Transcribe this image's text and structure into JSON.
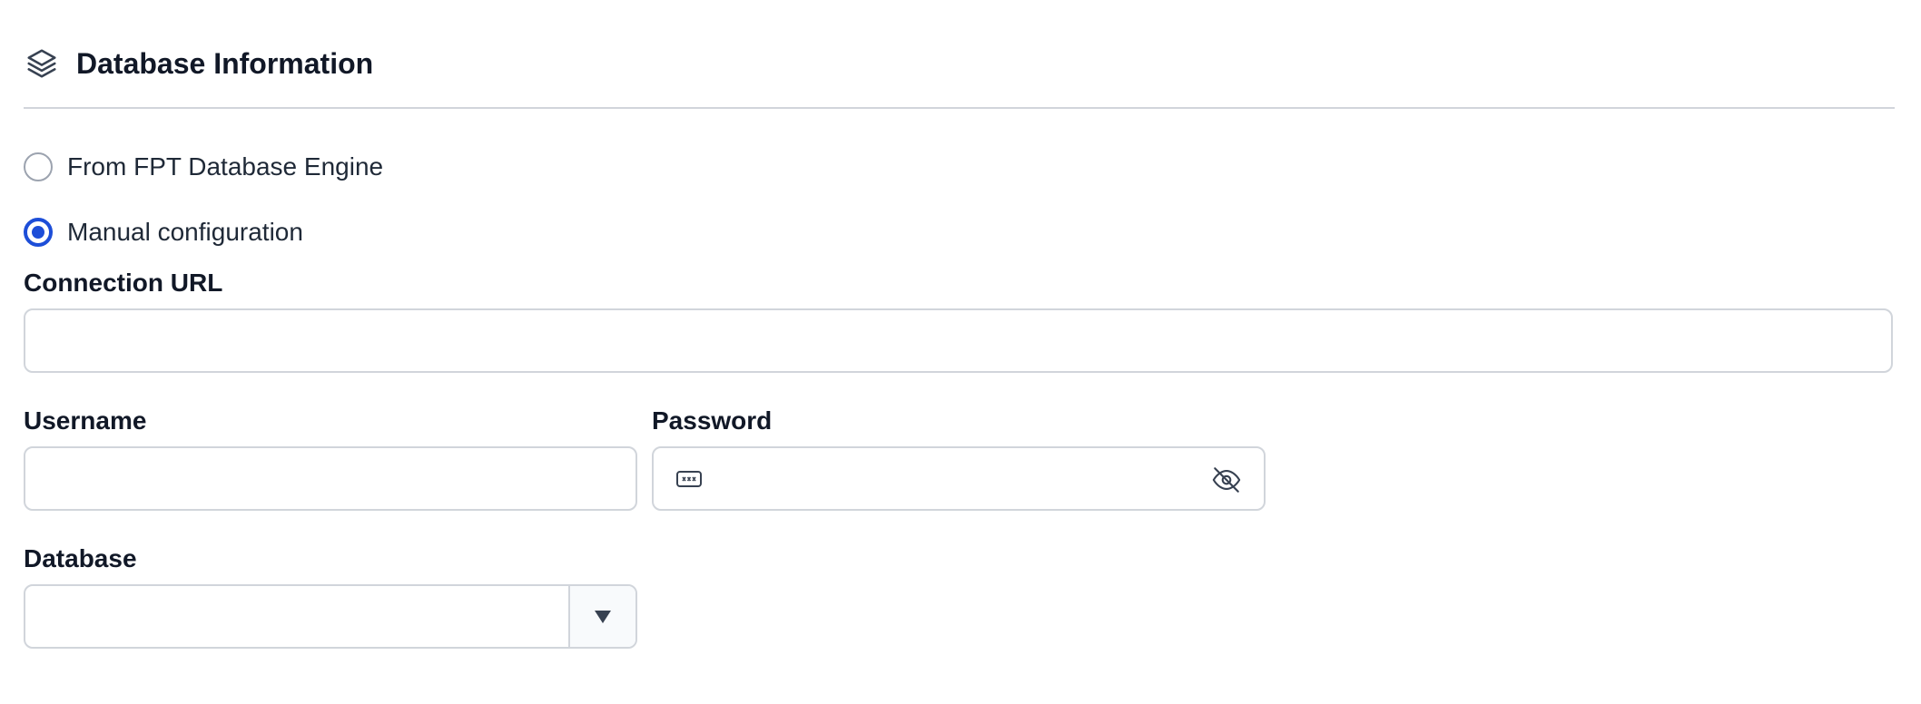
{
  "section": {
    "title": "Database Information",
    "icon": "layers-icon"
  },
  "source_options": [
    {
      "label": "From FPT Database Engine",
      "selected": false
    },
    {
      "label": "Manual configuration",
      "selected": true
    }
  ],
  "connection_url": {
    "label": "Connection URL",
    "value": "",
    "placeholder": ""
  },
  "username": {
    "label": "Username",
    "value": "",
    "placeholder": ""
  },
  "password": {
    "label": "Password",
    "value": "",
    "placeholder": "",
    "leading_icon": "password-icon",
    "toggle_icon": "eye-off-icon"
  },
  "database": {
    "label": "Database",
    "selected_value": "",
    "dropdown_icon": "caret-down-icon"
  },
  "colors": {
    "accent": "#1d4ed8",
    "border": "#d1d5db",
    "text": "#111827"
  }
}
